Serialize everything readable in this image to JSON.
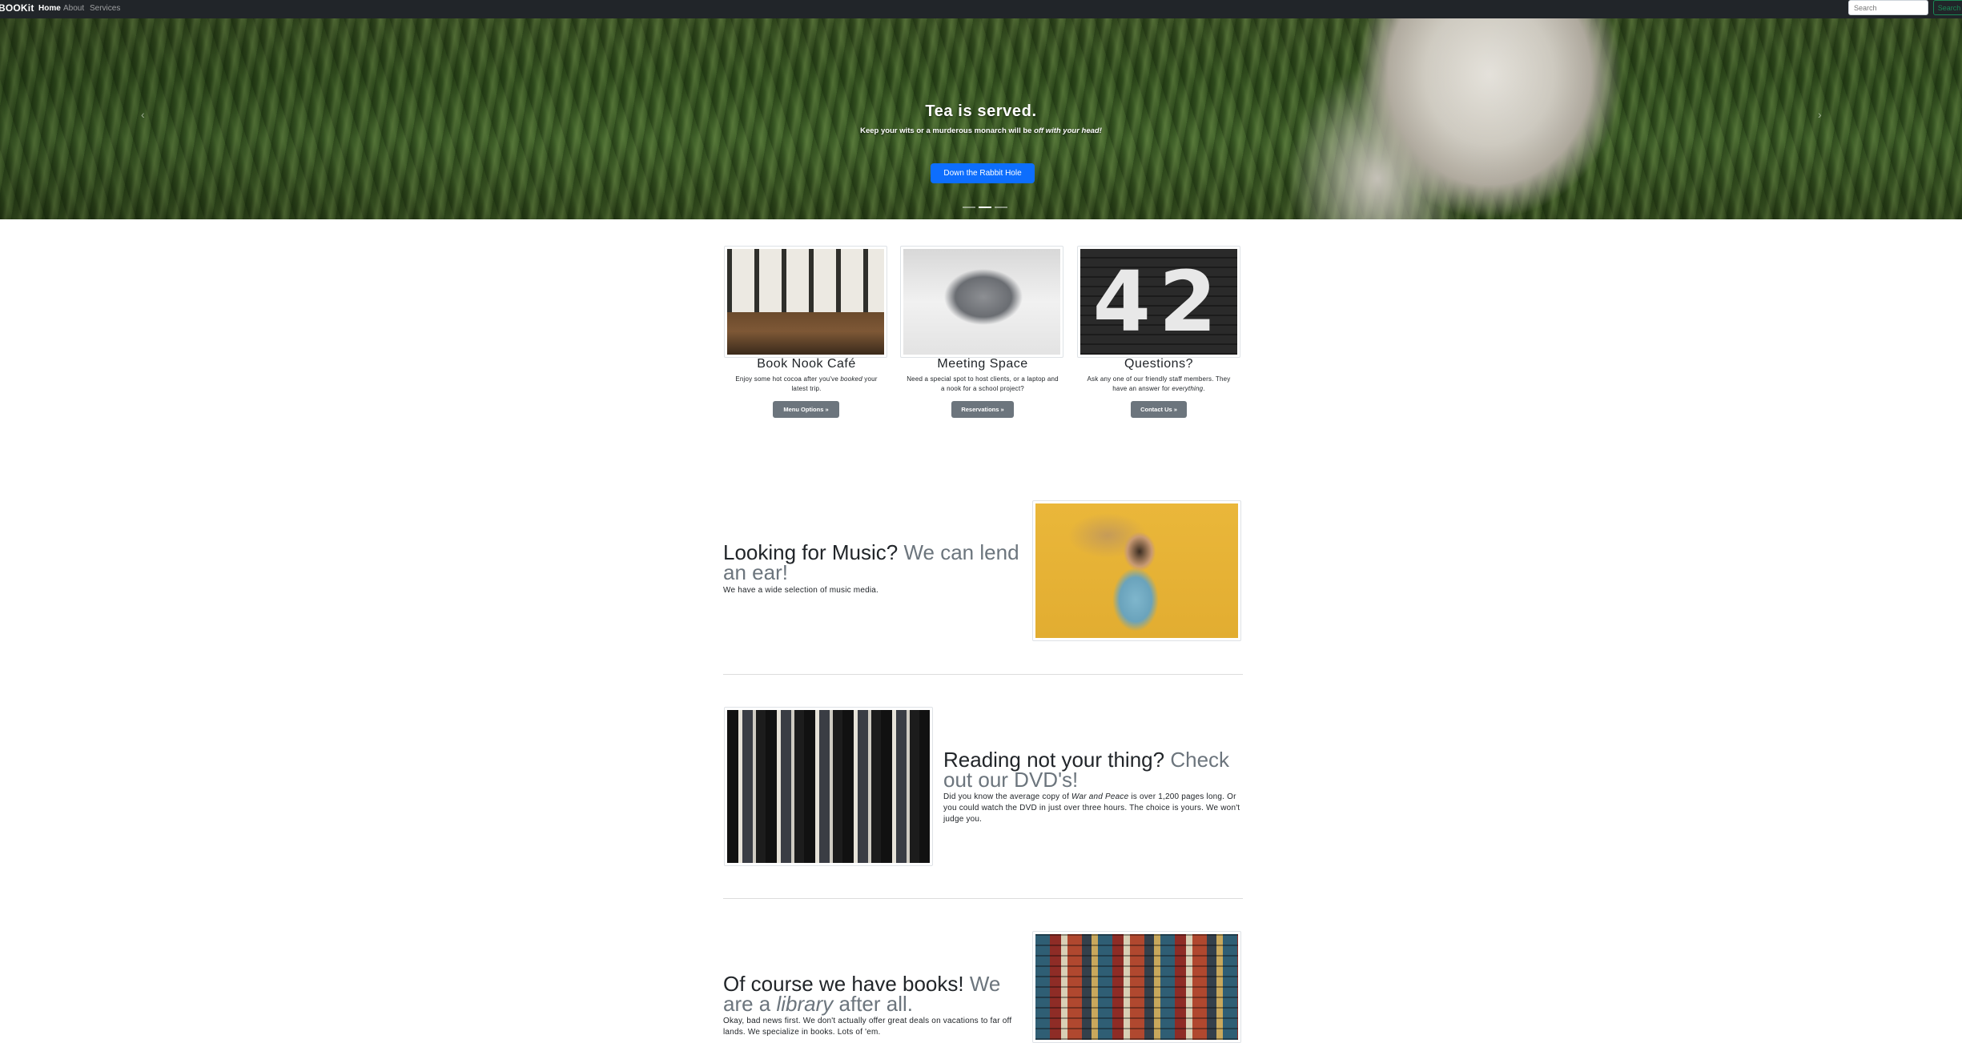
{
  "navbar": {
    "brand": "BOOKit",
    "links": [
      {
        "label": "Home",
        "active": true
      },
      {
        "label": "About",
        "active": false
      },
      {
        "label": "Services",
        "active": false
      }
    ],
    "search_placeholder": "Search",
    "search_button": "Search"
  },
  "hero": {
    "title": "Tea is served.",
    "subtitle_lead": "Keep your wits or a murderous monarch will be ",
    "subtitle_em": "off with your head!",
    "button": "Down the Rabbit Hole",
    "prev_icon": "‹",
    "next_icon": "›",
    "indicator_count": 3,
    "active_indicator": 2
  },
  "cards": [
    {
      "title": "Book Nook Café",
      "text_a": "Enjoy some hot cocoa after you've ",
      "text_em": "booked",
      "text_b": " your latest trip.",
      "button": "Menu Options »"
    },
    {
      "title": "Meeting Space",
      "text_a": "Need a special spot to host clients, or a laptop and a nook for a school project?",
      "text_em": "",
      "text_b": "",
      "button": "Reservations »"
    },
    {
      "title": "Questions?",
      "text_a": "Ask any one of our friendly staff members. They have an answer for ",
      "text_em": "everything",
      "text_b": ".",
      "button": "Contact Us »",
      "image_text": "42"
    }
  ],
  "featurettes": [
    {
      "heading": "Looking for Music?",
      "heading_muted": "We can lend an ear!",
      "text": "We have a wide selection of music media."
    },
    {
      "heading": "Reading not your thing?",
      "heading_muted": "Check out our DVD's!",
      "text_a": "Did you know the average copy of ",
      "text_em": "War and Peace",
      "text_b": " is over 1,200 pages long. Or you could watch the DVD in just over three hours. The choice is yours. We won't judge you."
    },
    {
      "heading": "Of course we have books!",
      "heading_muted_a": "We are a ",
      "heading_muted_em": "library",
      "heading_muted_b": " after all.",
      "text": "Okay, bad news first. We don't actually offer great deals on vacations to far off lands. We specialize in books. Lots of 'em."
    }
  ],
  "colors": {
    "navbar_bg": "#212529",
    "primary": "#0d6efd",
    "secondary": "#6c757d",
    "success": "#198754"
  }
}
